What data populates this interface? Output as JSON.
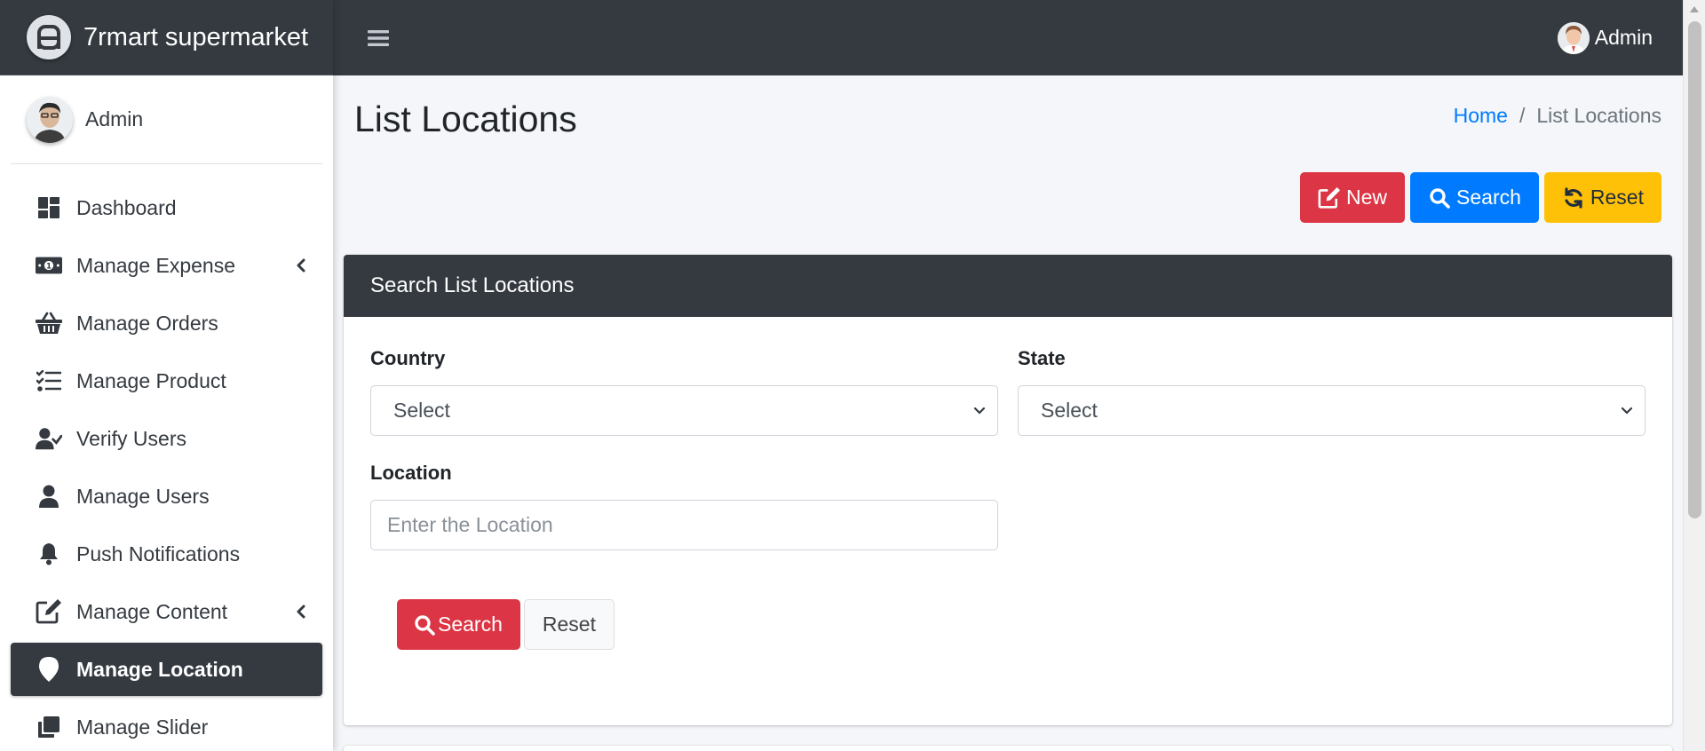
{
  "brand": {
    "name": "7rmart supermarket"
  },
  "sidebar": {
    "user": {
      "name": "Admin"
    },
    "items": [
      {
        "label": "Dashboard",
        "icon": "dashboard-icon"
      },
      {
        "label": "Manage Expense",
        "icon": "money-bill-icon",
        "has_submenu": true
      },
      {
        "label": "Manage Orders",
        "icon": "shopping-basket-icon"
      },
      {
        "label": "Manage Product",
        "icon": "tasks-list-icon"
      },
      {
        "label": "Verify Users",
        "icon": "user-check-icon"
      },
      {
        "label": "Manage Users",
        "icon": "user-icon"
      },
      {
        "label": "Push Notifications",
        "icon": "bell-icon"
      },
      {
        "label": "Manage Content",
        "icon": "edit-icon",
        "has_submenu": true
      },
      {
        "label": "Manage Location",
        "icon": "map-marker-icon",
        "active": true
      },
      {
        "label": "Manage Slider",
        "icon": "clone-icon"
      }
    ]
  },
  "topbar": {
    "user_name": "Admin"
  },
  "page": {
    "title": "List Locations",
    "breadcrumb": {
      "home": "Home",
      "current": "List Locations"
    }
  },
  "actions": {
    "new_label": "New",
    "search_label": "Search",
    "reset_label": "Reset"
  },
  "search_card": {
    "title": "Search List Locations",
    "country": {
      "label": "Country",
      "value": "Select"
    },
    "state": {
      "label": "State",
      "value": "Select"
    },
    "location": {
      "label": "Location",
      "placeholder": "Enter the Location"
    },
    "search_button": "Search",
    "reset_button": "Reset"
  },
  "colors": {
    "dark": "#343a40",
    "danger": "#dc3545",
    "primary": "#007bff",
    "warning": "#ffc107",
    "background": "#f4f6f9"
  }
}
